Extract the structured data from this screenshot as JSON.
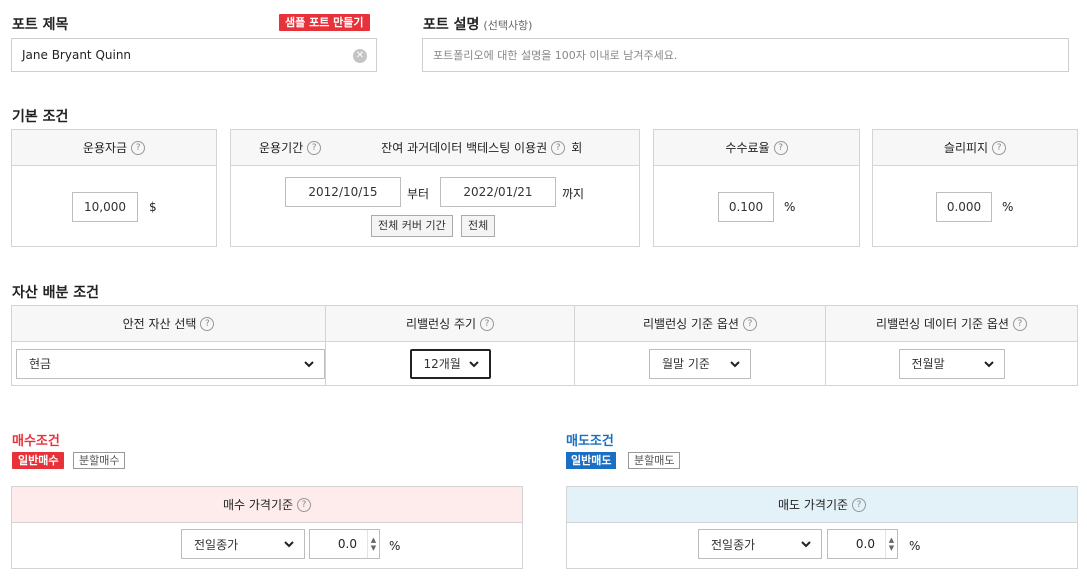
{
  "port": {
    "title_label": "포트 제목",
    "sample_button": "샘플 포트 만들기",
    "title_value": "Jane Bryant Quinn",
    "desc_label": "포트 설명",
    "desc_optional": "(선택사항)",
    "desc_placeholder": "포트폴리오에 대한 설명을 100자 이내로 남겨주세요."
  },
  "basic": {
    "section_title": "기본 조건",
    "capital": {
      "label": "운용자금",
      "value": "10,000",
      "unit": "$"
    },
    "period": {
      "label": "운용기간",
      "ticket_label": "잔여 과거데이터 백테스팅 이용권",
      "ticket_unit": "회",
      "start": "2012/10/15",
      "start_suffix": "부터",
      "end": "2022/01/21",
      "end_suffix": "까지",
      "full_cover_button": "전체 커버 기간",
      "all_button": "전체"
    },
    "fee": {
      "label": "수수료율",
      "value": "0.100",
      "unit": "%"
    },
    "slippage": {
      "label": "슬리피지",
      "value": "0.000",
      "unit": "%"
    }
  },
  "asset": {
    "section_title": "자산 배분 조건",
    "safe_asset": {
      "label": "안전 자산 선택",
      "value": "현금"
    },
    "rebalance_period": {
      "label": "리밸런싱 주기",
      "value": "12개월"
    },
    "rebalance_option": {
      "label": "리밸런싱 기준 옵션",
      "value": "월말 기준"
    },
    "rebalance_data": {
      "label": "리밸런싱 데이터 기준 옵션",
      "value": "전월말"
    }
  },
  "buy": {
    "title": "매수조건",
    "normal_tab": "일반매수",
    "split_tab": "분할매수",
    "price_label": "매수 가격기준",
    "price_basis": "전일종가",
    "pct": "0.0",
    "unit": "%"
  },
  "sell": {
    "title": "매도조건",
    "normal_tab": "일반매도",
    "split_tab": "분할매도",
    "price_label": "매도 가격기준",
    "price_basis": "전일종가",
    "pct": "0.0",
    "unit": "%"
  },
  "colors": {
    "accent_red": "#e8323a",
    "accent_blue": "#1b6fc2",
    "buy_head_bg": "#fdeceb",
    "sell_head_bg": "#e2f2f8"
  }
}
